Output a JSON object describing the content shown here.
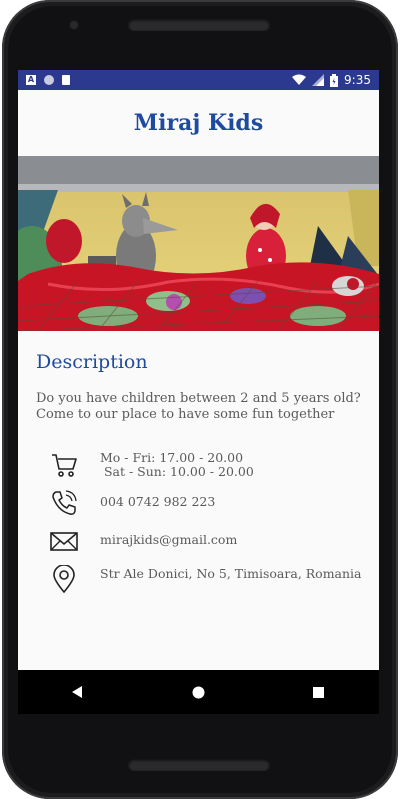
{
  "status_bar": {
    "time": "9:35",
    "icons": [
      "android-notification-icon",
      "circle-icon",
      "sd-card-icon",
      "wifi-icon",
      "signal-icon",
      "battery-icon"
    ]
  },
  "app": {
    "title": "Miraj Kids"
  },
  "hero_image": {
    "alt": "puppet-show-image"
  },
  "description": {
    "heading": "Description",
    "text_line1": "Do you have children between 2 and 5 years old?",
    "text_line2": "Come to our place to have some fun together"
  },
  "info": {
    "hours_line1": "Mo - Fri: 17.00 - 20.00",
    "hours_line2": " Sat - Sun: 10.00 - 20.00",
    "phone": "004 0742 982 223",
    "email": "mirajkids@gmail.com",
    "address": "Str Ale Donici, No 5, Timisoara, Romania"
  },
  "colors": {
    "accent": "#1e4aa0",
    "status_bar": "#2b3a8f",
    "text": "#5a5a5a",
    "background": "#fafafa"
  },
  "nav_bar": {
    "buttons": [
      "back-icon",
      "home-icon",
      "recents-icon"
    ]
  }
}
